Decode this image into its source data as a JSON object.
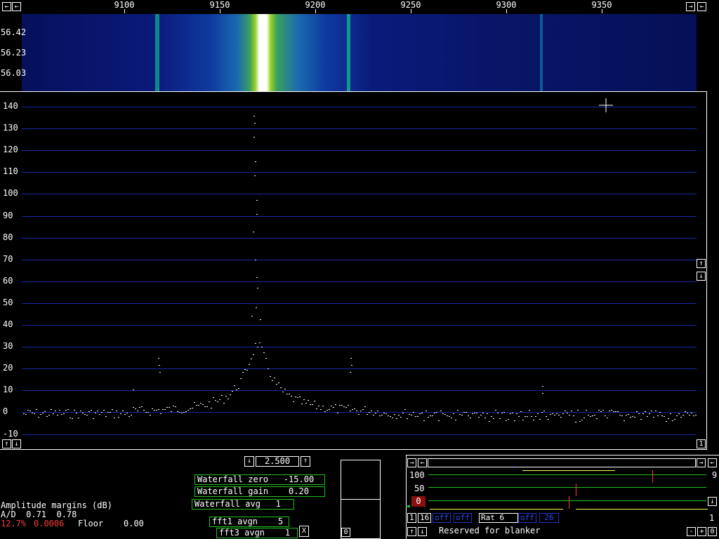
{
  "freq_axis": {
    "labels": [
      "9100",
      "9150",
      "9200",
      "9250",
      "9300",
      "9350"
    ]
  },
  "waterfall": {
    "time_labels": [
      "56.42",
      "56.23",
      "56.03"
    ]
  },
  "spectrum": {
    "y_labels": [
      "140",
      "130",
      "120",
      "110",
      "100",
      "90",
      "80",
      "70",
      "60",
      "50",
      "40",
      "30",
      "20",
      "10",
      "0",
      "-10"
    ]
  },
  "nav": {
    "left": "←",
    "right": "→",
    "up": "↑",
    "down": "↓",
    "one": "1",
    "x": "X",
    "zero": "0",
    "minus": "-",
    "plus": "+"
  },
  "bandwidth": {
    "value": "2.500"
  },
  "params": {
    "waterfall_zero": "Waterfall zero   -15.00",
    "waterfall_gain": "Waterfall gain    0.20",
    "waterfall_avg": "Waterfall avg   1",
    "fft1_avgn": "fft1 avgn    5",
    "fft3_avgn": "fft3 avgn    1"
  },
  "status": {
    "amplitude_margins": "Amplitude margins (dB)",
    "ad_line": "A/D  0.71  0.78",
    "percent": "12.7%",
    "floor_value_red": "0.0006",
    "floor_label": "Floor",
    "floor_value": "0.00"
  },
  "small_panel": {
    "zero_label": "0"
  },
  "blanker": {
    "levels": [
      "100",
      "50"
    ],
    "zero_box": "0",
    "right_top": "9",
    "right_bottom": "1",
    "btn_1": "1",
    "btn_16": "16",
    "off1": "off",
    "off2": "off",
    "rat": "Rat  6",
    "off3": "off",
    "val26": "26",
    "reserved": "Reserved for blanker"
  },
  "colors": {
    "grid": "#1a2aa8",
    "param_border": "#22c122",
    "accent_red": "#ff3a3a"
  }
}
